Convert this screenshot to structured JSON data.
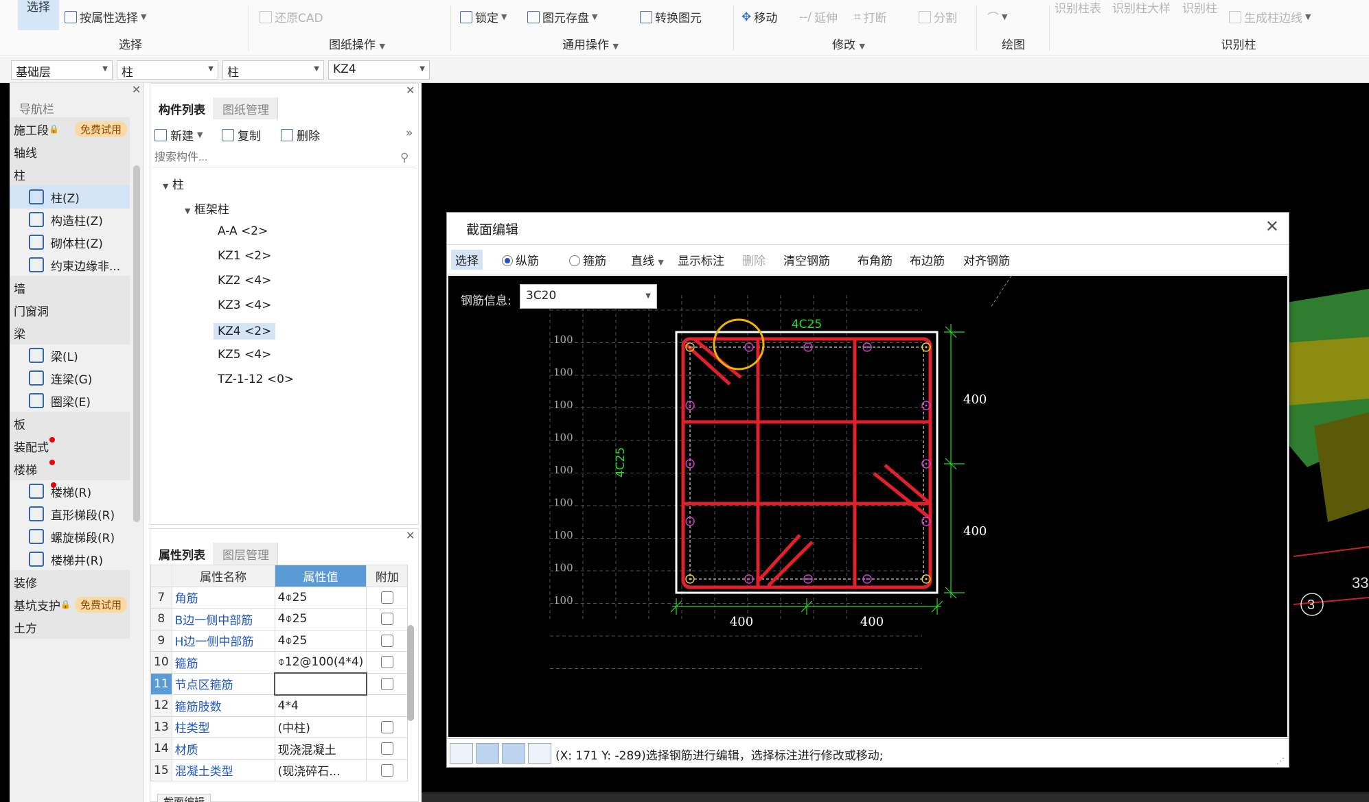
{
  "ribbon": {
    "select_big": "选择",
    "select_by_attr": "按属性选择",
    "group_select": "选择",
    "restore_cad": "还原CAD",
    "group_drawing": "图纸操作",
    "lock": "锁定",
    "save_element": "图元存盘",
    "convert_element": "转换图元",
    "group_common": "通用操作",
    "move": "移动",
    "extend": "延伸",
    "break": "打断",
    "split": "分割",
    "group_modify": "修改",
    "group_draw": "绘图",
    "recog_col_table": "识别柱表",
    "recog_col_detail": "识别柱大样",
    "recog_col": "识别柱",
    "gen_col_edge": "生成柱边线",
    "group_recog_col": "识别柱"
  },
  "combos": {
    "layer": "基础层",
    "type1": "柱",
    "type2": "柱",
    "component": "KZ4"
  },
  "nav": {
    "title": "导航栏",
    "free_trial": "免费试用",
    "rows": [
      {
        "label": "施工段",
        "kind": "cat",
        "lock": true,
        "badge": true
      },
      {
        "label": "轴线",
        "kind": "cat"
      },
      {
        "label": "柱",
        "kind": "cat"
      },
      {
        "label": "柱(Z)",
        "kind": "item",
        "selected": true
      },
      {
        "label": "构造柱(Z)",
        "kind": "item"
      },
      {
        "label": "砌体柱(Z)",
        "kind": "item"
      },
      {
        "label": "约束边缘非...",
        "kind": "item"
      },
      {
        "label": "墙",
        "kind": "cat"
      },
      {
        "label": "门窗洞",
        "kind": "cat"
      },
      {
        "label": "梁",
        "kind": "cat"
      },
      {
        "label": "梁(L)",
        "kind": "item"
      },
      {
        "label": "连梁(G)",
        "kind": "item"
      },
      {
        "label": "圈梁(E)",
        "kind": "item"
      },
      {
        "label": "板",
        "kind": "cat"
      },
      {
        "label": "装配式",
        "kind": "cat",
        "dot": true
      },
      {
        "label": "楼梯",
        "kind": "cat",
        "dot": true
      },
      {
        "label": "楼梯(R)",
        "kind": "item",
        "dot": true
      },
      {
        "label": "直形梯段(R)",
        "kind": "item"
      },
      {
        "label": "螺旋梯段(R)",
        "kind": "item"
      },
      {
        "label": "楼梯井(R)",
        "kind": "item"
      },
      {
        "label": "装修",
        "kind": "cat"
      },
      {
        "label": "基坑支护",
        "kind": "cat",
        "lock": true,
        "badge": true
      },
      {
        "label": "土方",
        "kind": "cat"
      }
    ]
  },
  "comp": {
    "tab_list": "构件列表",
    "tab_drawing": "图纸管理",
    "new": "新建",
    "copy": "复制",
    "delete": "删除",
    "search_placeholder": "搜索构件...",
    "root": "柱",
    "group": "框架柱",
    "items": [
      "A-A <2>",
      "KZ1 <2>",
      "KZ2 <4>",
      "KZ3 <4>",
      "KZ4 <2>",
      "KZ5 <4>",
      "TZ-1-12 <0>"
    ]
  },
  "props": {
    "tab_props": "属性列表",
    "tab_layers": "图层管理",
    "col_name": "属性名称",
    "col_value": "属性值",
    "col_extra": "附加",
    "rows": [
      {
        "n": "7",
        "name": "角筋",
        "value": "4⌽25",
        "ck": true
      },
      {
        "n": "8",
        "name": "B边一侧中部筋",
        "value": "4⌽25",
        "ck": true
      },
      {
        "n": "9",
        "name": "H边一侧中部筋",
        "value": "4⌽25",
        "ck": true
      },
      {
        "n": "10",
        "name": "箍筋",
        "value": "⌽12@100(4*4)",
        "ck": true
      },
      {
        "n": "11",
        "name": "节点区箍筋",
        "value": "",
        "ck": true
      },
      {
        "n": "12",
        "name": "箍筋肢数",
        "value": "4*4",
        "ck": false
      },
      {
        "n": "13",
        "name": "柱类型",
        "value": "(中柱)",
        "ck": true
      },
      {
        "n": "14",
        "name": "材质",
        "value": "现浇混凝土",
        "ck": true
      },
      {
        "n": "15",
        "name": "混凝土类型",
        "value": "(现浇碎石...",
        "ck": true
      }
    ],
    "bottom_tab": "截面编辑"
  },
  "dialog": {
    "title": "截面编辑",
    "btn_select": "选择",
    "radio_long": "纵筋",
    "radio_stirrup": "箍筋",
    "btn_line": "直线",
    "btn_show_dim": "显示标注",
    "btn_delete": "删除",
    "btn_clear": "清空钢筋",
    "btn_corner": "布角筋",
    "btn_edge": "布边筋",
    "btn_align": "对齐钢筋",
    "rebar_label": "钢筋信息:",
    "rebar_value": "3C20",
    "status": "(X: 171 Y: -289)选择钢筋进行编辑，选择标注进行修改或移动;"
  },
  "section": {
    "top_label": "4C25",
    "side_label": "4C25",
    "dim_right_top": "400",
    "dim_right_bottom": "400",
    "dim_bottom_left": "400",
    "dim_bottom_right": "400",
    "grid_labels": [
      "100",
      "100",
      "100",
      "100",
      "100",
      "100",
      "100",
      "100",
      "100"
    ],
    "colors": {
      "rebar": "#e0202a",
      "dim": "#22dd22",
      "bar_dot": "#d23ad2",
      "corner_dot": "#e6d22a",
      "highlight": "#f0b400"
    }
  },
  "viewport": {
    "label_3": "3",
    "label_33": "33"
  }
}
